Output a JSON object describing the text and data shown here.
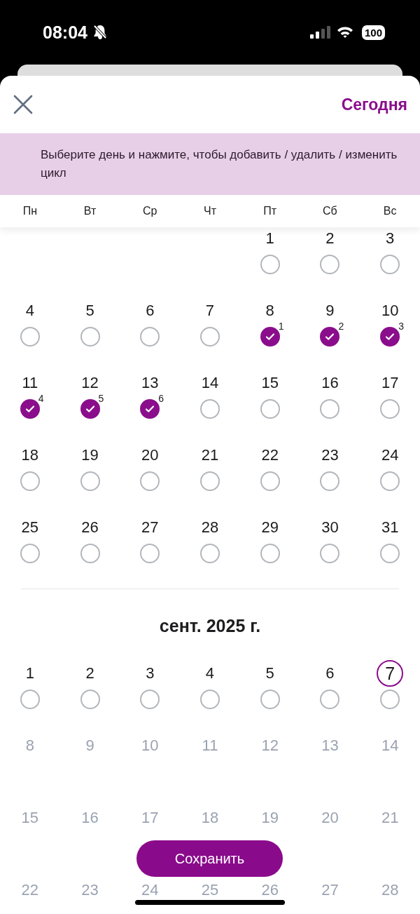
{
  "status_bar": {
    "time": "08:04",
    "battery": "100"
  },
  "header": {
    "today_link": "Сегодня"
  },
  "banner": "Выберите день и нажмите, чтобы добавить / удалить / изменить цикл",
  "weekdays": [
    "Пн",
    "Вт",
    "Ср",
    "Чт",
    "Пт",
    "Сб",
    "Вс"
  ],
  "months": [
    {
      "weeks": [
        [
          {
            "kind": "empty"
          },
          {
            "kind": "empty"
          },
          {
            "kind": "empty"
          },
          {
            "kind": "empty"
          },
          {
            "kind": "day",
            "label": "1",
            "checked": false,
            "today": false
          },
          {
            "kind": "day",
            "label": "2",
            "checked": false,
            "today": false
          },
          {
            "kind": "day",
            "label": "3",
            "checked": false,
            "today": false
          }
        ],
        [
          {
            "kind": "day",
            "label": "4",
            "checked": false,
            "today": false
          },
          {
            "kind": "day",
            "label": "5",
            "checked": false,
            "today": false
          },
          {
            "kind": "day",
            "label": "6",
            "checked": false,
            "today": false
          },
          {
            "kind": "day",
            "label": "7",
            "checked": false,
            "today": false
          },
          {
            "kind": "day",
            "label": "8",
            "checked": true,
            "cycle_day": "1",
            "today": false
          },
          {
            "kind": "day",
            "label": "9",
            "checked": true,
            "cycle_day": "2",
            "today": false
          },
          {
            "kind": "day",
            "label": "10",
            "checked": true,
            "cycle_day": "3",
            "today": false
          }
        ],
        [
          {
            "kind": "day",
            "label": "11",
            "checked": true,
            "cycle_day": "4",
            "today": false
          },
          {
            "kind": "day",
            "label": "12",
            "checked": true,
            "cycle_day": "5",
            "today": false
          },
          {
            "kind": "day",
            "label": "13",
            "checked": true,
            "cycle_day": "6",
            "today": false
          },
          {
            "kind": "day",
            "label": "14",
            "checked": false,
            "today": false
          },
          {
            "kind": "day",
            "label": "15",
            "checked": false,
            "today": false
          },
          {
            "kind": "day",
            "label": "16",
            "checked": false,
            "today": false
          },
          {
            "kind": "day",
            "label": "17",
            "checked": false,
            "today": false
          }
        ],
        [
          {
            "kind": "day",
            "label": "18",
            "checked": false,
            "today": false
          },
          {
            "kind": "day",
            "label": "19",
            "checked": false,
            "today": false
          },
          {
            "kind": "day",
            "label": "20",
            "checked": false,
            "today": false
          },
          {
            "kind": "day",
            "label": "21",
            "checked": false,
            "today": false
          },
          {
            "kind": "day",
            "label": "22",
            "checked": false,
            "today": false
          },
          {
            "kind": "day",
            "label": "23",
            "checked": false,
            "today": false
          },
          {
            "kind": "day",
            "label": "24",
            "checked": false,
            "today": false
          }
        ],
        [
          {
            "kind": "day",
            "label": "25",
            "checked": false,
            "today": false
          },
          {
            "kind": "day",
            "label": "26",
            "checked": false,
            "today": false
          },
          {
            "kind": "day",
            "label": "27",
            "checked": false,
            "today": false
          },
          {
            "kind": "day",
            "label": "28",
            "checked": false,
            "today": false
          },
          {
            "kind": "day",
            "label": "29",
            "checked": false,
            "today": false
          },
          {
            "kind": "day",
            "label": "30",
            "checked": false,
            "today": false
          },
          {
            "kind": "day",
            "label": "31",
            "checked": false,
            "today": false
          }
        ]
      ]
    },
    {
      "title": "сент. 2025 г.",
      "weeks": [
        [
          {
            "kind": "day",
            "label": "1",
            "checked": false,
            "today": false
          },
          {
            "kind": "day",
            "label": "2",
            "checked": false,
            "today": false
          },
          {
            "kind": "day",
            "label": "3",
            "checked": false,
            "today": false
          },
          {
            "kind": "day",
            "label": "4",
            "checked": false,
            "today": false
          },
          {
            "kind": "day",
            "label": "5",
            "checked": false,
            "today": false
          },
          {
            "kind": "day",
            "label": "6",
            "checked": false,
            "today": false
          },
          {
            "kind": "day",
            "label": "7",
            "checked": false,
            "today": true
          }
        ],
        [
          {
            "kind": "future",
            "label": "8"
          },
          {
            "kind": "future",
            "label": "9"
          },
          {
            "kind": "future",
            "label": "10"
          },
          {
            "kind": "future",
            "label": "11"
          },
          {
            "kind": "future",
            "label": "12"
          },
          {
            "kind": "future",
            "label": "13"
          },
          {
            "kind": "future",
            "label": "14"
          }
        ],
        [
          {
            "kind": "future",
            "label": "15"
          },
          {
            "kind": "future",
            "label": "16"
          },
          {
            "kind": "future",
            "label": "17"
          },
          {
            "kind": "future",
            "label": "18"
          },
          {
            "kind": "future",
            "label": "19"
          },
          {
            "kind": "future",
            "label": "20"
          },
          {
            "kind": "future",
            "label": "21"
          }
        ],
        [
          {
            "kind": "future",
            "label": "22"
          },
          {
            "kind": "future",
            "label": "23"
          },
          {
            "kind": "future",
            "label": "24"
          },
          {
            "kind": "future",
            "label": "25"
          },
          {
            "kind": "future",
            "label": "26"
          },
          {
            "kind": "future",
            "label": "27"
          },
          {
            "kind": "future",
            "label": "28"
          }
        ]
      ]
    }
  ],
  "save_button": "Сохранить"
}
